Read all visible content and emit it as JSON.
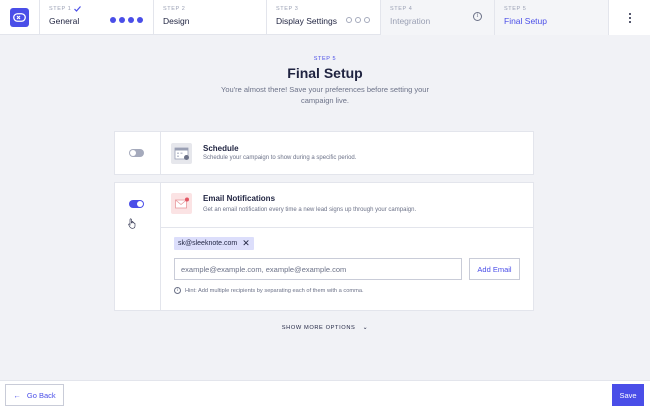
{
  "steps": [
    {
      "label": "STEP 1",
      "name": "General",
      "done": true
    },
    {
      "label": "STEP 2",
      "name": "Design"
    },
    {
      "label": "STEP 3",
      "name": "Display Settings"
    },
    {
      "label": "STEP 4",
      "name": "Integration"
    },
    {
      "label": "STEP 5",
      "name": "Final Setup"
    }
  ],
  "heading": {
    "step_label": "STEP 5",
    "title": "Final Setup",
    "subtitle": "You're almost there! Save your preferences before setting your campaign live."
  },
  "schedule": {
    "title": "Schedule",
    "description": "Schedule your campaign to show during a specific period.",
    "enabled": false
  },
  "email_notifications": {
    "title": "Email Notifications",
    "description": "Get an email notification every time a new lead signs up through your campaign.",
    "enabled": true,
    "recipients": [
      "sk@sleeknote.com"
    ],
    "input_placeholder": "example@example.com, example@example.com",
    "add_button": "Add Email",
    "hint": "Hint: Add multiple recipients by separating each of them with a comma."
  },
  "show_more": "SHOW MORE OPTIONS",
  "footer": {
    "back": "Go Back",
    "save": "Save"
  },
  "colors": {
    "accent": "#4a4ee8",
    "background": "#f1f2f6",
    "text": "#1f2340",
    "muted": "#6c7288"
  }
}
